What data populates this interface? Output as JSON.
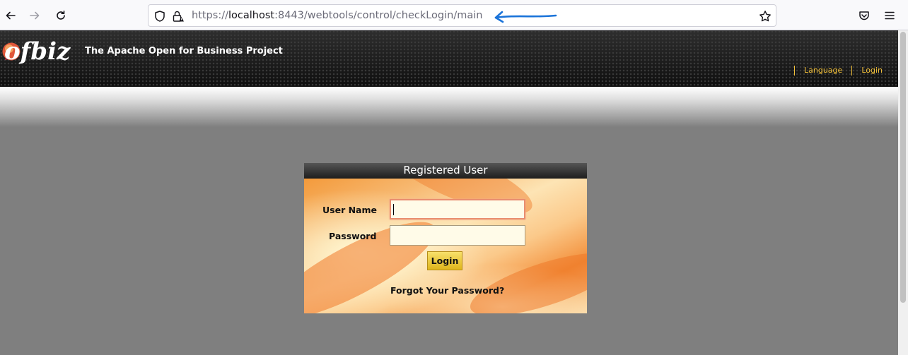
{
  "browser": {
    "url_prefix": "https://",
    "url_host": "localhost",
    "url_rest": ":8443/webtools/control/checkLogin/main"
  },
  "header": {
    "logo_text": "ofbiz",
    "tagline": "The Apache Open for Business Project",
    "links": [
      "Language",
      "Login"
    ]
  },
  "login": {
    "title": "Registered User",
    "username_label": "User Name",
    "username_value": "",
    "password_label": "Password",
    "password_value": "",
    "submit_label": "Login",
    "forgot_label": "Forgot Your Password?"
  },
  "colors": {
    "annotation_arrow": "#1a73d9",
    "header_link": "#f3c13a"
  }
}
